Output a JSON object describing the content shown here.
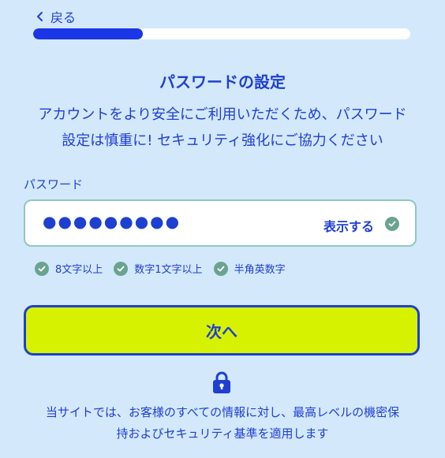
{
  "nav": {
    "back_label": "戻る"
  },
  "progress": {
    "fraction": 0.29
  },
  "header": {
    "title": "パスワードの設定",
    "description_line1": "アカウントをより安全にご利用いただくため、パスワード",
    "description_line2": "設定は慎重に! セキュリティ強化にご協力ください"
  },
  "password": {
    "label": "パスワード",
    "value": "●●●●●●●●●",
    "show_label": "表示する"
  },
  "rules": [
    {
      "label": "8文字以上"
    },
    {
      "label": "数字1文字以上"
    },
    {
      "label": "半角英数字"
    }
  ],
  "actions": {
    "next_label": "次へ"
  },
  "footer": {
    "line1": "当サイトでは、お客様のすべての情報に対し、最高レベルの機密保",
    "line2": "持およびセキュリティ基準を適用します"
  },
  "colors": {
    "background": "#d3e8fb",
    "primary": "#1f3fd0",
    "progress_fill": "#1b36e6",
    "button_bg": "#d6f201",
    "check_green": "#6ba391",
    "input_border": "#8fc8bb"
  },
  "icons": {
    "back": "chevron-left-icon",
    "check": "check-circle-icon",
    "lock": "lock-icon"
  }
}
